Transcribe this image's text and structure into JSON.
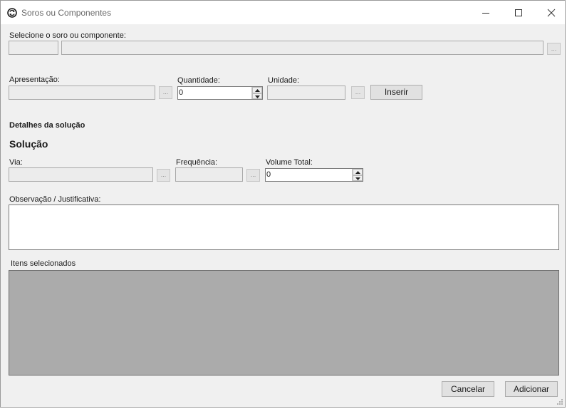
{
  "window": {
    "title": "Soros ou Componentes",
    "minimize_label": "",
    "maximize_label": "",
    "close_label": ""
  },
  "selection": {
    "label": "Selecione o soro ou componente:",
    "code_value": "",
    "name_value": "",
    "browse_label": "..."
  },
  "presentation": {
    "apresentacao_label": "Apresentação:",
    "apresentacao_value": "",
    "apresentacao_browse": "...",
    "quantidade_label": "Quantidade:",
    "quantidade_value": "0",
    "unidade_label": "Unidade:",
    "unidade_value": "",
    "unidade_browse": "...",
    "insert_label": "Inserir"
  },
  "details": {
    "section_title": "Detalhes da solução",
    "solution_title": "Solução",
    "via_label": "Via:",
    "via_value": "",
    "via_browse": "...",
    "frequencia_label": "Frequência:",
    "frequencia_value": "",
    "frequencia_browse": "...",
    "volume_label": "Volume Total:",
    "volume_value": "0"
  },
  "notes": {
    "label": "Observação / Justificativa:",
    "value": ""
  },
  "selected_items": {
    "label": "Itens selecionados",
    "rows": []
  },
  "footer": {
    "cancel_label": "Cancelar",
    "add_label": "Adicionar"
  },
  "colors": {
    "window_bg": "#f0f0f0",
    "grid_bg": "#ababab",
    "button_bg": "#e1e1e1"
  }
}
